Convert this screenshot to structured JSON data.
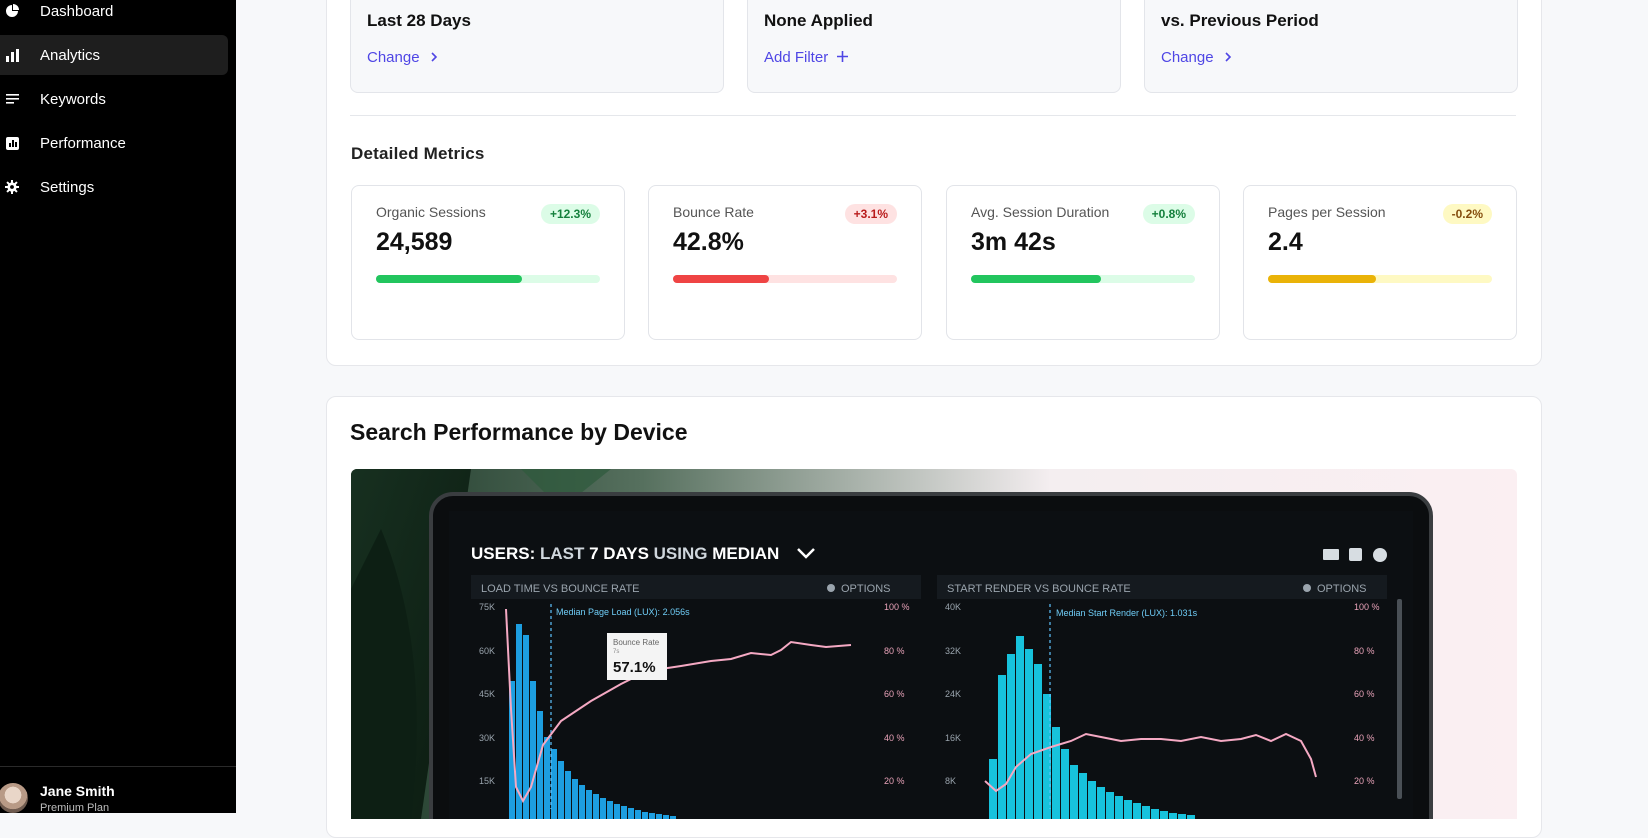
{
  "sidebar": {
    "items": [
      {
        "label": "Dashboard",
        "icon": "pie-chart-icon"
      },
      {
        "label": "Analytics",
        "icon": "bar-chart-icon",
        "active": true
      },
      {
        "label": "Keywords",
        "icon": "list-icon"
      },
      {
        "label": "Performance",
        "icon": "chart-square-icon"
      },
      {
        "label": "Settings",
        "icon": "gear-icon"
      }
    ],
    "user": {
      "name": "Jane Smith",
      "plan": "Premium Plan"
    }
  },
  "filters": [
    {
      "value": "Last 28 Days",
      "link": "Change",
      "link_icon": "chevron-right-icon"
    },
    {
      "value": "None Applied",
      "link": "Add Filter",
      "link_icon": "plus-icon"
    },
    {
      "value": "vs. Previous Period",
      "link": "Change",
      "link_icon": "chevron-right-icon"
    }
  ],
  "detailed_metrics": {
    "title": "Detailed Metrics",
    "metrics": [
      {
        "label": "Organic Sessions",
        "value": "24,589",
        "change": "+12.3%",
        "progress": 0.65,
        "fill_color": "#22c55e",
        "track_color": "#dcfce7",
        "badge_bg": "#dcfce7",
        "badge_color": "#15803d"
      },
      {
        "label": "Bounce Rate",
        "value": "42.8%",
        "change": "+3.1%",
        "progress": 0.43,
        "fill_color": "#ef4444",
        "track_color": "#fee2e2",
        "badge_bg": "#fee2e2",
        "badge_color": "#b91c1c"
      },
      {
        "label": "Avg. Session Duration",
        "value": "3m 42s",
        "change": "+0.8%",
        "progress": 0.58,
        "fill_color": "#22c55e",
        "track_color": "#dcfce7",
        "badge_bg": "#dcfce7",
        "badge_color": "#15803d"
      },
      {
        "label": "Pages per Session",
        "value": "2.4",
        "change": "-0.2%",
        "progress": 0.48,
        "fill_color": "#eab308",
        "track_color": "#fef9c3",
        "badge_bg": "#fef9c3",
        "badge_color": "#854d0e"
      }
    ]
  },
  "search_performance": {
    "title": "Search Performance by Device",
    "image": {
      "header_parts": [
        "USERS: ",
        "LAST ",
        "7 DAYS ",
        "USING ",
        "MEDIAN"
      ],
      "left_panel": {
        "title": "LOAD TIME VS BOUNCE RATE",
        "options": "OPTIONS",
        "median_label": "Median Page Load (LUX): 2.056s",
        "y_left": [
          "75K",
          "60K",
          "45K",
          "30K",
          "15K"
        ],
        "y_right": [
          "100 %",
          "80 %",
          "60 %",
          "40 %",
          "20 %"
        ],
        "tooltip_label": "Bounce Rate",
        "tooltip_sub": "7s",
        "tooltip_value": "57.1%"
      },
      "right_panel": {
        "title": "START RENDER VS BOUNCE RATE",
        "options": "OPTIONS",
        "median_label": "Median Start Render (LUX): 1.031s",
        "y_left": [
          "40K",
          "32K",
          "24K",
          "16K",
          "8K"
        ],
        "y_right": [
          "100 %",
          "80 %",
          "60 %",
          "40 %",
          "20 %"
        ]
      }
    }
  }
}
